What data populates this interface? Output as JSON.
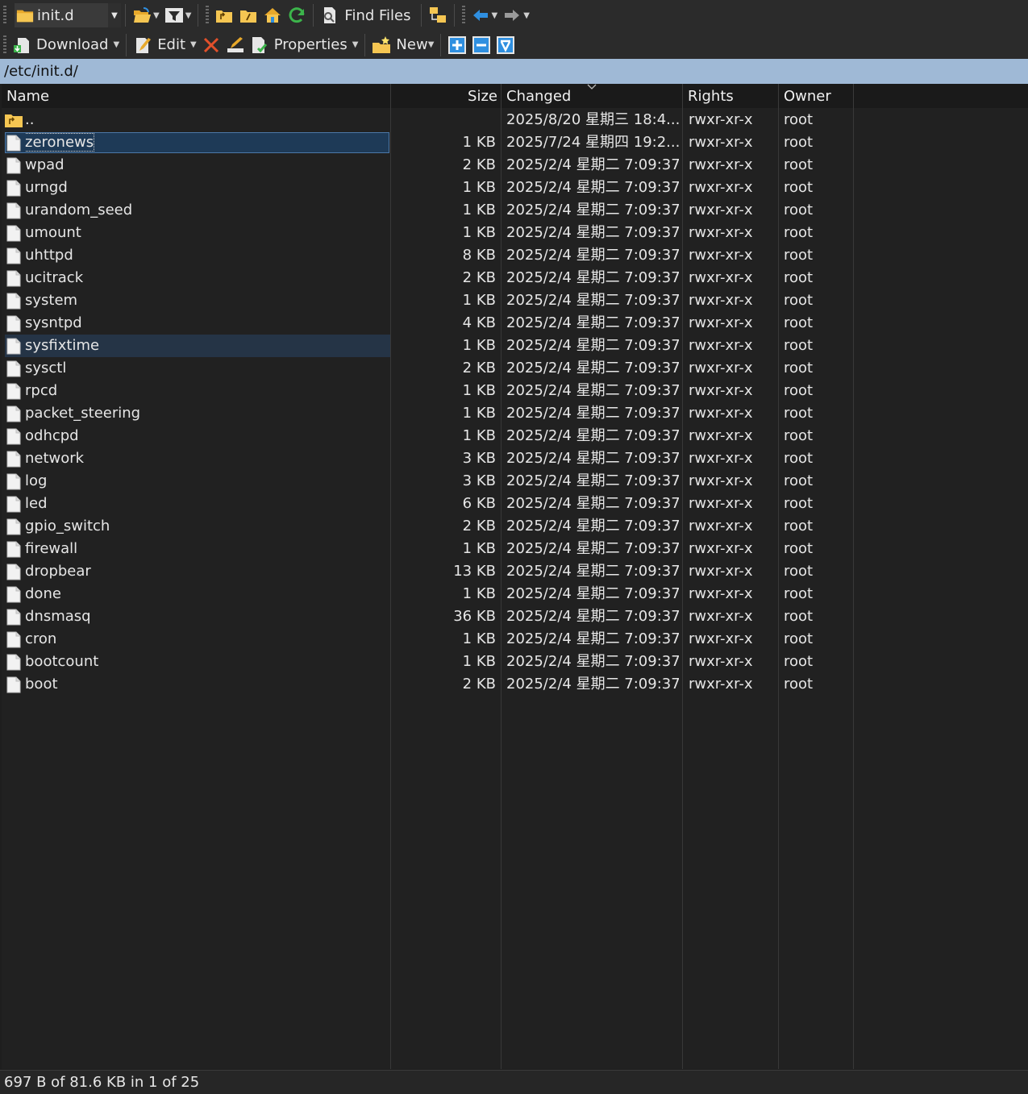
{
  "toolbar1": {
    "location_combo": "init.d",
    "find_files_label": "Find Files"
  },
  "toolbar2": {
    "download_label": "Download",
    "edit_label": "Edit",
    "properties_label": "Properties",
    "new_label": "New"
  },
  "path": "/etc/init.d/",
  "columns": {
    "name": "Name",
    "size": "Size",
    "changed": "Changed",
    "rights": "Rights",
    "owner": "Owner"
  },
  "sort": {
    "column": "changed",
    "direction": "descending"
  },
  "files": [
    {
      "name": "..",
      "size": "",
      "changed": "2025/8/20 星期三 18:4...",
      "rights": "rwxr-xr-x",
      "owner": "root",
      "type": "parent"
    },
    {
      "name": "zeronews",
      "size": "1 KB",
      "changed": "2025/7/24 星期四 19:2...",
      "rights": "rwxr-xr-x",
      "owner": "root",
      "type": "file",
      "state": "focus"
    },
    {
      "name": "wpad",
      "size": "2 KB",
      "changed": "2025/2/4 星期二 7:09:37",
      "rights": "rwxr-xr-x",
      "owner": "root",
      "type": "file"
    },
    {
      "name": "urngd",
      "size": "1 KB",
      "changed": "2025/2/4 星期二 7:09:37",
      "rights": "rwxr-xr-x",
      "owner": "root",
      "type": "file"
    },
    {
      "name": "urandom_seed",
      "size": "1 KB",
      "changed": "2025/2/4 星期二 7:09:37",
      "rights": "rwxr-xr-x",
      "owner": "root",
      "type": "file"
    },
    {
      "name": "umount",
      "size": "1 KB",
      "changed": "2025/2/4 星期二 7:09:37",
      "rights": "rwxr-xr-x",
      "owner": "root",
      "type": "file"
    },
    {
      "name": "uhttpd",
      "size": "8 KB",
      "changed": "2025/2/4 星期二 7:09:37",
      "rights": "rwxr-xr-x",
      "owner": "root",
      "type": "file"
    },
    {
      "name": "ucitrack",
      "size": "2 KB",
      "changed": "2025/2/4 星期二 7:09:37",
      "rights": "rwxr-xr-x",
      "owner": "root",
      "type": "file"
    },
    {
      "name": "system",
      "size": "1 KB",
      "changed": "2025/2/4 星期二 7:09:37",
      "rights": "rwxr-xr-x",
      "owner": "root",
      "type": "file"
    },
    {
      "name": "sysntpd",
      "size": "4 KB",
      "changed": "2025/2/4 星期二 7:09:37",
      "rights": "rwxr-xr-x",
      "owner": "root",
      "type": "file"
    },
    {
      "name": "sysfixtime",
      "size": "1 KB",
      "changed": "2025/2/4 星期二 7:09:37",
      "rights": "rwxr-xr-x",
      "owner": "root",
      "type": "file",
      "state": "hover"
    },
    {
      "name": "sysctl",
      "size": "2 KB",
      "changed": "2025/2/4 星期二 7:09:37",
      "rights": "rwxr-xr-x",
      "owner": "root",
      "type": "file"
    },
    {
      "name": "rpcd",
      "size": "1 KB",
      "changed": "2025/2/4 星期二 7:09:37",
      "rights": "rwxr-xr-x",
      "owner": "root",
      "type": "file"
    },
    {
      "name": "packet_steering",
      "size": "1 KB",
      "changed": "2025/2/4 星期二 7:09:37",
      "rights": "rwxr-xr-x",
      "owner": "root",
      "type": "file"
    },
    {
      "name": "odhcpd",
      "size": "1 KB",
      "changed": "2025/2/4 星期二 7:09:37",
      "rights": "rwxr-xr-x",
      "owner": "root",
      "type": "file"
    },
    {
      "name": "network",
      "size": "3 KB",
      "changed": "2025/2/4 星期二 7:09:37",
      "rights": "rwxr-xr-x",
      "owner": "root",
      "type": "file"
    },
    {
      "name": "log",
      "size": "3 KB",
      "changed": "2025/2/4 星期二 7:09:37",
      "rights": "rwxr-xr-x",
      "owner": "root",
      "type": "file"
    },
    {
      "name": "led",
      "size": "6 KB",
      "changed": "2025/2/4 星期二 7:09:37",
      "rights": "rwxr-xr-x",
      "owner": "root",
      "type": "file"
    },
    {
      "name": "gpio_switch",
      "size": "2 KB",
      "changed": "2025/2/4 星期二 7:09:37",
      "rights": "rwxr-xr-x",
      "owner": "root",
      "type": "file"
    },
    {
      "name": "firewall",
      "size": "1 KB",
      "changed": "2025/2/4 星期二 7:09:37",
      "rights": "rwxr-xr-x",
      "owner": "root",
      "type": "file"
    },
    {
      "name": "dropbear",
      "size": "13 KB",
      "changed": "2025/2/4 星期二 7:09:37",
      "rights": "rwxr-xr-x",
      "owner": "root",
      "type": "file"
    },
    {
      "name": "done",
      "size": "1 KB",
      "changed": "2025/2/4 星期二 7:09:37",
      "rights": "rwxr-xr-x",
      "owner": "root",
      "type": "file"
    },
    {
      "name": "dnsmasq",
      "size": "36 KB",
      "changed": "2025/2/4 星期二 7:09:37",
      "rights": "rwxr-xr-x",
      "owner": "root",
      "type": "file"
    },
    {
      "name": "cron",
      "size": "1 KB",
      "changed": "2025/2/4 星期二 7:09:37",
      "rights": "rwxr-xr-x",
      "owner": "root",
      "type": "file"
    },
    {
      "name": "bootcount",
      "size": "1 KB",
      "changed": "2025/2/4 星期二 7:09:37",
      "rights": "rwxr-xr-x",
      "owner": "root",
      "type": "file"
    },
    {
      "name": "boot",
      "size": "2 KB",
      "changed": "2025/2/4 星期二 7:09:37",
      "rights": "rwxr-xr-x",
      "owner": "root",
      "type": "file"
    }
  ],
  "status": "697 B of 81.6 KB in 1 of 25",
  "colors": {
    "background": "#1e1e1e",
    "toolbar": "#2b2b2b",
    "pathbar": "#9fb9d6",
    "selection": "#1e3a57",
    "hover": "#253446",
    "folder": "#f2c14e",
    "accent_blue": "#2f8fe0"
  },
  "icons": {
    "folder": "folder-icon",
    "file": "file-icon",
    "parent": "parent-folder-icon"
  }
}
